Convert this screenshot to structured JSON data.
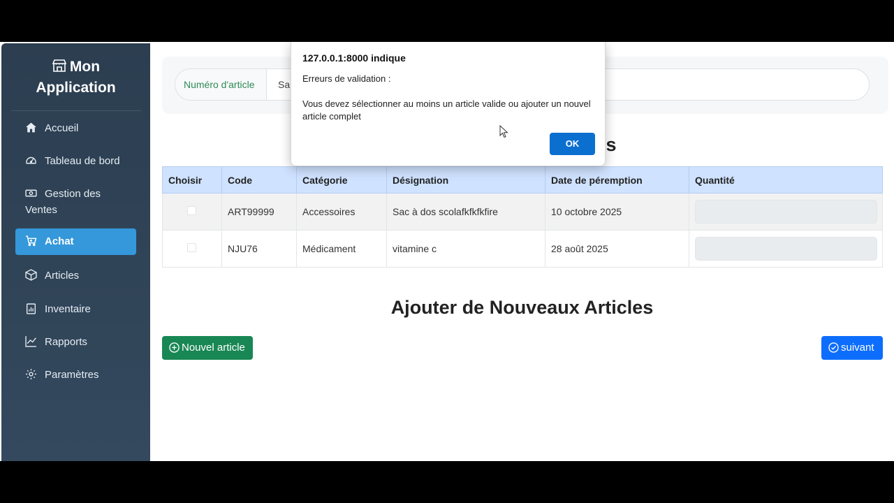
{
  "sidebar": {
    "brand_line1": "Mon",
    "brand_line2": "Application",
    "items": [
      {
        "label": "Accueil",
        "icon": "home-icon"
      },
      {
        "label": "Tableau de bord",
        "icon": "dashboard-icon"
      },
      {
        "label_line1": "Gestion des",
        "label_line2": "Ventes",
        "icon": "cash-icon"
      },
      {
        "label": "Achat",
        "icon": "cart-icon",
        "active": true
      },
      {
        "label": "Articles",
        "icon": "box-icon"
      },
      {
        "label": "Inventaire",
        "icon": "clipboard-chart-icon"
      },
      {
        "label": "Rapports",
        "icon": "line-chart-icon"
      },
      {
        "label": "Paramètres",
        "icon": "gear-icon"
      }
    ]
  },
  "search": {
    "label": "Numéro d'article",
    "value": "Sa"
  },
  "section_title_partial": "s",
  "table": {
    "headers": [
      "Choisir",
      "Code",
      "Catégorie",
      "Désignation",
      "Date de péremption",
      "Quantité"
    ],
    "rows": [
      {
        "code": "ART99999",
        "categorie": "Accessoires",
        "designation": "Sac à dos scolafkfkfkfire",
        "date": "10 octobre 2025",
        "quantite": ""
      },
      {
        "code": "NJU76",
        "categorie": "Médicament",
        "designation": "vitamine c",
        "date": "28 août 2025",
        "quantite": ""
      }
    ]
  },
  "add_section_title": "Ajouter de Nouveaux Articles",
  "buttons": {
    "new_article": "Nouvel article",
    "next": "suivant"
  },
  "dialog": {
    "origin": "127.0.0.1:8000 indique",
    "message1": "Erreurs de validation :",
    "message2": "Vous devez sélectionner au moins un article valide ou ajouter un nouvel article complet",
    "ok": "OK"
  },
  "colors": {
    "sidebar_bg": "#2c3e50",
    "active_item": "#3498db",
    "table_header": "#cfe2ff",
    "btn_success": "#198754",
    "btn_primary": "#0d6efd",
    "dialog_ok": "#0b6fd0"
  }
}
